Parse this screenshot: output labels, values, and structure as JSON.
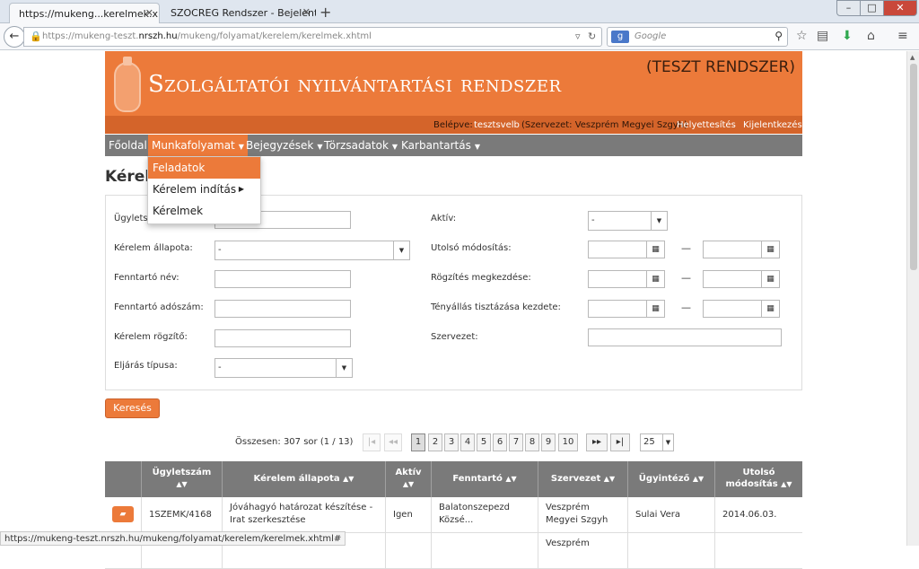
{
  "browser": {
    "tabs": [
      {
        "label": "https://mukeng...kerelmek.xhtml"
      },
      {
        "label": "SZOCREG Rendszer - Bejelentk..."
      }
    ],
    "url_prefix": "https://mukeng-teszt.",
    "url_domain": "nrszh.hu",
    "url_path": "/mukeng/folyamat/kerelem/kerelmek.xhtml",
    "search_placeholder": "Google",
    "search_engine": "g",
    "status_url": "https://mukeng-teszt.nrszh.hu/mukeng/folyamat/kerelem/kerelmek.xhtml#"
  },
  "header": {
    "title": "Szolgáltatói nyilvántartási rendszer",
    "env": "(TESZT RENDSZER)",
    "login_label": "Belépve:",
    "login_user": "tesztsvelb",
    "org": "(Szervezet: Veszprém Megyei Szgyh)",
    "substitution": "Helyettesítés",
    "logout": "Kijelentkezés"
  },
  "menu": {
    "items": [
      {
        "label": "Főoldal"
      },
      {
        "label": "Munkafolyamat"
      },
      {
        "label": "Bejegyzések"
      },
      {
        "label": "Törzsadatok"
      },
      {
        "label": "Karbantartás"
      }
    ],
    "dropdown": [
      {
        "label": "Feladatok"
      },
      {
        "label": "Kérelem indítás"
      },
      {
        "label": "Kérelmek"
      }
    ]
  },
  "page_title": "Kérelmek",
  "form": {
    "ugyletszam": "Ügyletszám:",
    "kerelem_allapota": "Kérelem állapota:",
    "kerelem_allapota_value": "-",
    "fenntarto_nev": "Fenntartó név:",
    "fenntarto_adoszam": "Fenntartó adószám:",
    "kerelem_rogzito": "Kérelem rögzítő:",
    "eljaras_tipusa": "Eljárás típusa:",
    "eljaras_tipusa_value": "-",
    "aktiv": "Aktív:",
    "aktiv_value": "-",
    "utolso_modositas": "Utolsó módosítás:",
    "rogzites_megkezdese": "Rögzítés megkezdése:",
    "tenyallas": "Tényállás tisztázása kezdete:",
    "szervezet": "Szervezet:",
    "range_sep": "—"
  },
  "search_button": "Keresés",
  "pagination": {
    "summary": "Összesen: 307 sor (1 / 13)",
    "first": "|◂",
    "prev": "◂◂",
    "pages": [
      "1",
      "2",
      "3",
      "4",
      "5",
      "6",
      "7",
      "8",
      "9",
      "10"
    ],
    "next": "▸▸",
    "last": "▸|",
    "page_size": "25",
    "current_page": 1
  },
  "table": {
    "columns": [
      "Ügyletszám",
      "Kérelem állapota",
      "Aktív",
      "Fenntartó",
      "Szervezet",
      "Ügyintéző",
      "Utolsó módosítás"
    ],
    "rows": [
      {
        "ugyletszam": "1SZEMK/4168",
        "allapot": "Jóváhagyó határozat készítése - Irat szerkesztése",
        "aktiv": "Igen",
        "fenntarto": "Balatonszepezd Közsé...",
        "szervezet": "Veszprém Megyei Szgyh",
        "ugyintezo": "Sulai Vera",
        "modositas": "2014.06.03."
      },
      {
        "ugyletszam": "",
        "allapot": "",
        "aktiv": "",
        "fenntarto": "",
        "szervezet": "Veszprém",
        "ugyintezo": "",
        "modositas": ""
      }
    ]
  },
  "colors": {
    "accent": "#ec7a3a",
    "menu_bg": "#7a7a7a"
  }
}
